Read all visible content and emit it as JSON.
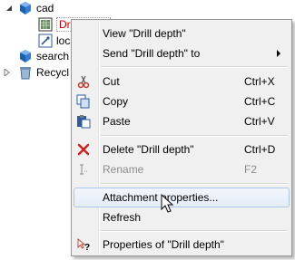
{
  "tree": {
    "items": [
      {
        "label": "cad"
      },
      {
        "label": "Drill depth"
      },
      {
        "label": "loc"
      },
      {
        "label": "search"
      },
      {
        "label": "Recycl"
      }
    ]
  },
  "menu": {
    "view": "View \"Drill depth\"",
    "send_to": "Send \"Drill depth\" to",
    "cut": "Cut",
    "cut_sc": "Ctrl+X",
    "copy": "Copy",
    "copy_sc": "Ctrl+C",
    "paste": "Paste",
    "paste_sc": "Ctrl+V",
    "delete": "Delete \"Drill depth\"",
    "delete_sc": "Ctrl+D",
    "rename": "Rename",
    "rename_sc": "F2",
    "attachment": "Attachment properties...",
    "refresh": "Refresh",
    "properties": "Properties of \"Drill depth\""
  },
  "colors": {
    "accent": "#1a64b4",
    "delete": "#d21f1f",
    "cut": "#c0392b"
  }
}
